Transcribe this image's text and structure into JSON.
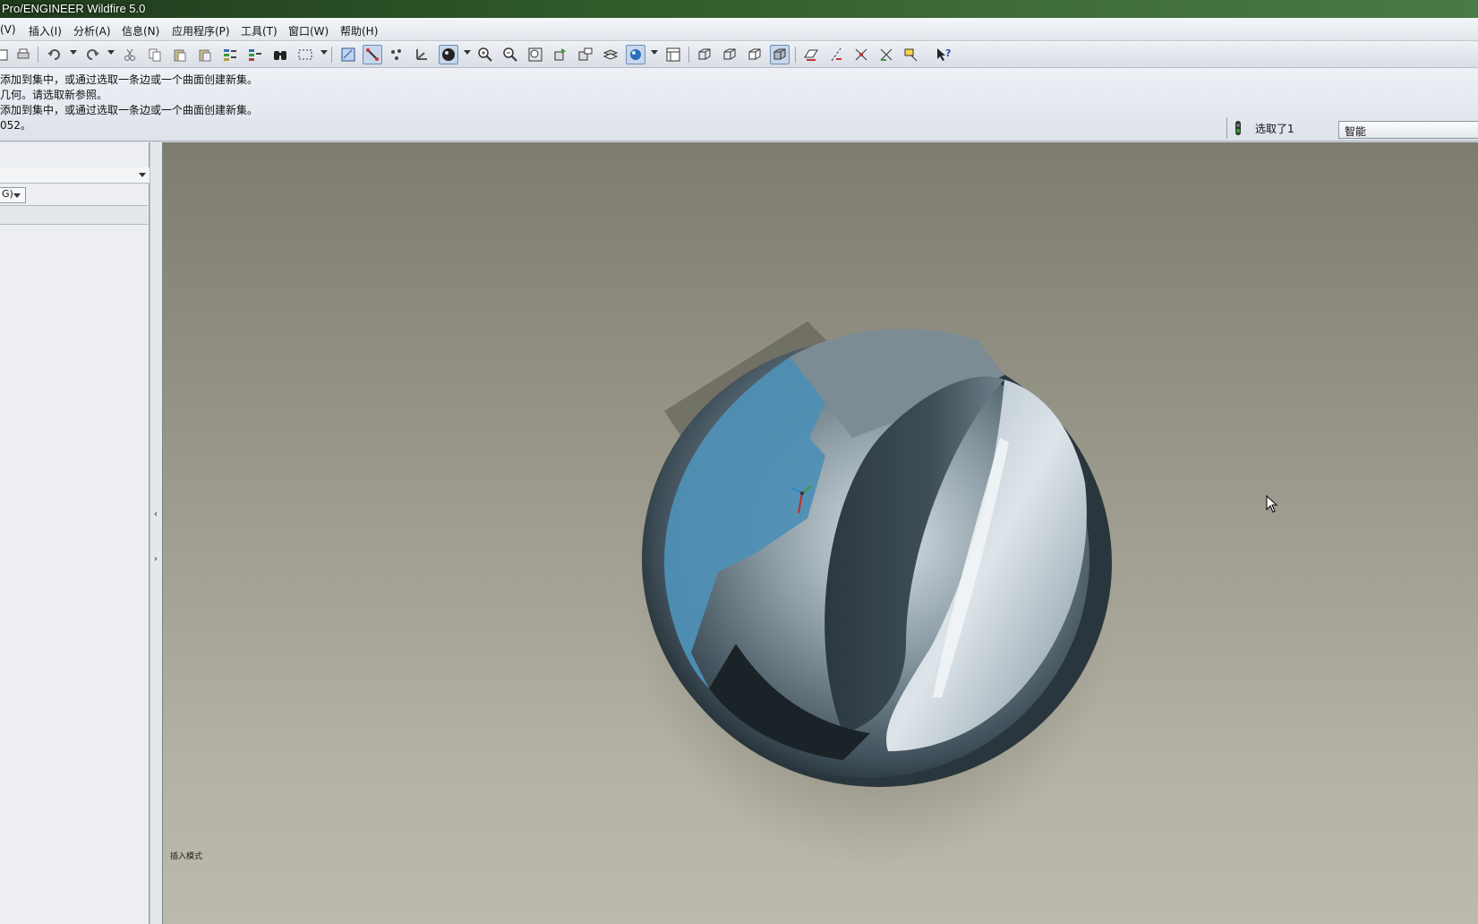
{
  "window": {
    "title": "Pro/ENGINEER Wildfire 5.0"
  },
  "menu": {
    "items": [
      "(V)",
      "插入(I)",
      "分析(A)",
      "信息(N)",
      "应用程序(P)",
      "工具(T)",
      "窗口(W)",
      "帮助(H)"
    ]
  },
  "messages": {
    "lines": [
      "添加到集中，或通过选取一条边或一个曲面创建新集。",
      "几何。请选取新参照。",
      "添加到集中，或通过选取一条边或一个曲面创建新集。",
      "052。"
    ]
  },
  "status": {
    "selection_text": "选取了1",
    "filter_value": "智能",
    "light_color": "#3a9a3a"
  },
  "left_panel": {
    "combo_value": "G)"
  },
  "viewport": {
    "mode_text": "插入模式",
    "background_top": "#7e7c6e",
    "background_bottom": "#bcbaac"
  },
  "toolbar": {
    "icons": [
      "open-icon",
      "print-icon",
      "undo-icon",
      "redo-icon",
      "cut-icon",
      "copy-icon",
      "paste-icon",
      "paste-special-icon",
      "regenerate-icon",
      "regen-manager-icon",
      "find-icon",
      "select-box-icon",
      "plane-display-icon",
      "axis-display-icon",
      "point-display-icon",
      "csys-display-icon",
      "shading-icon",
      "zoom-in-icon",
      "zoom-out-icon",
      "refit-icon",
      "reorient-icon",
      "saved-views-icon",
      "layers-icon",
      "appearance-icon",
      "view-manager-icon",
      "wireframe-icon",
      "hidden-line-icon",
      "no-hidden-icon",
      "shaded-icon",
      "datum-plane-icon",
      "datum-axis-icon",
      "datum-point-icon",
      "csys-icon",
      "annotation-icon",
      "context-help-icon"
    ]
  }
}
